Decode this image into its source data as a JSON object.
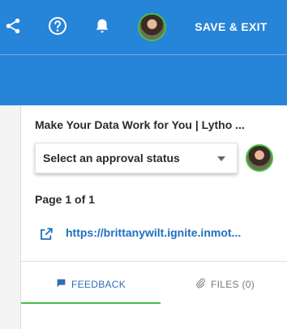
{
  "header": {
    "save_exit_label": "SAVE & EXIT",
    "icons": [
      "share-icon",
      "help-icon",
      "bell-icon"
    ]
  },
  "document": {
    "title": "Make Your Data Work for You | Lytho ...",
    "approval_status_placeholder": "Select an approval status",
    "page_count": "Page 1 of 1",
    "link_text": "https://brittanywilt.ignite.inmot..."
  },
  "tabs": [
    {
      "label": "FEEDBACK",
      "icon": "comment-icon",
      "active": true
    },
    {
      "label": "FILES (0)",
      "icon": "paperclip-icon",
      "active": false
    }
  ],
  "colors": {
    "header_bg": "#2684d9",
    "accent_green": "#48c046",
    "link_blue": "#1f6fc0"
  }
}
